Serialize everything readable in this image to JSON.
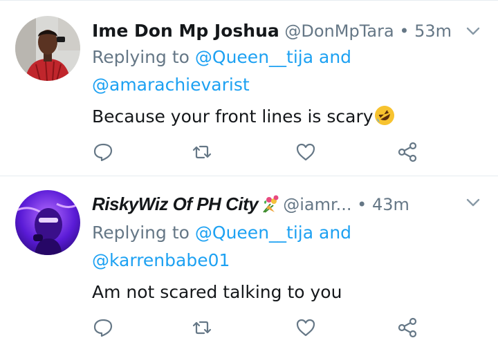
{
  "tweets": [
    {
      "name": "Ime Don Mp Joshua",
      "handle": "@DonMpTara",
      "separator": "•",
      "time": "53m",
      "replying_prefix": "Replying to",
      "reply_to_1": "@Queen__tija",
      "reply_and": "and",
      "reply_to_2": "@amarachievarist",
      "text": "Because your front lines is scary",
      "emoji": "rolling-on-floor-laughing-emoji",
      "avatar": "user-photo-red-shirt"
    },
    {
      "name": "RiskyWiz Of PH City",
      "handle": "@iamr...",
      "separator": "•",
      "time": "43m",
      "replying_prefix": "Replying to",
      "reply_to_1": "@Queen__tija",
      "reply_and": "and",
      "reply_to_2": "@karrenbabe01",
      "text": "Am not scared talking to you",
      "name_emoji": "bouquet-emoji",
      "avatar": "user-photo-purple-neon"
    }
  ],
  "icons": {
    "reply": "reply-icon",
    "retweet": "retweet-icon",
    "like": "heart-icon",
    "share": "share-icon",
    "menu": "chevron-down-icon"
  },
  "colors": {
    "link": "#1da1f2",
    "muted": "#657786",
    "text": "#14171a"
  }
}
